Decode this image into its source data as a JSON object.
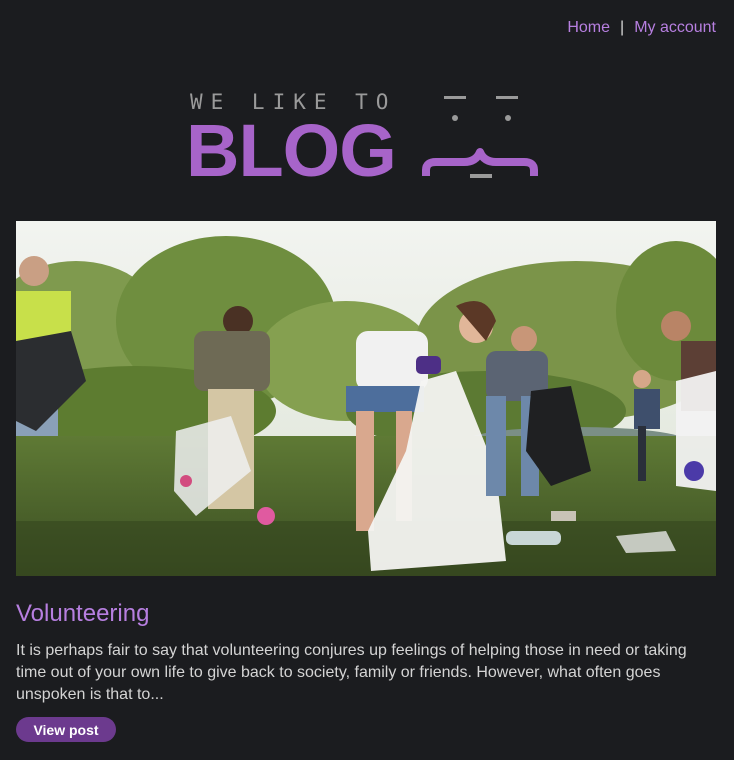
{
  "nav": {
    "home_label": "Home",
    "separator": "|",
    "account_label": "My account"
  },
  "logo": {
    "small_text": "WE LIKE TO",
    "big_text": "BLOG",
    "icon": "face-brackets-icon",
    "accent_color": "#a764c9",
    "gray_color": "#9a9a9a"
  },
  "hero": {
    "icon": "volunteers-litter-picking-photo"
  },
  "post": {
    "title": "Volunteering",
    "excerpt": "It is perhaps fair to say that volunteering conjures up feelings of helping those in need or taking time out of your own life to give back to society, family or friends. However, what often goes unspoken is that to...",
    "button_label": "View post"
  },
  "colors": {
    "background": "#1b1c1f",
    "link": "#b77fe0",
    "button": "#6c3a8e"
  }
}
